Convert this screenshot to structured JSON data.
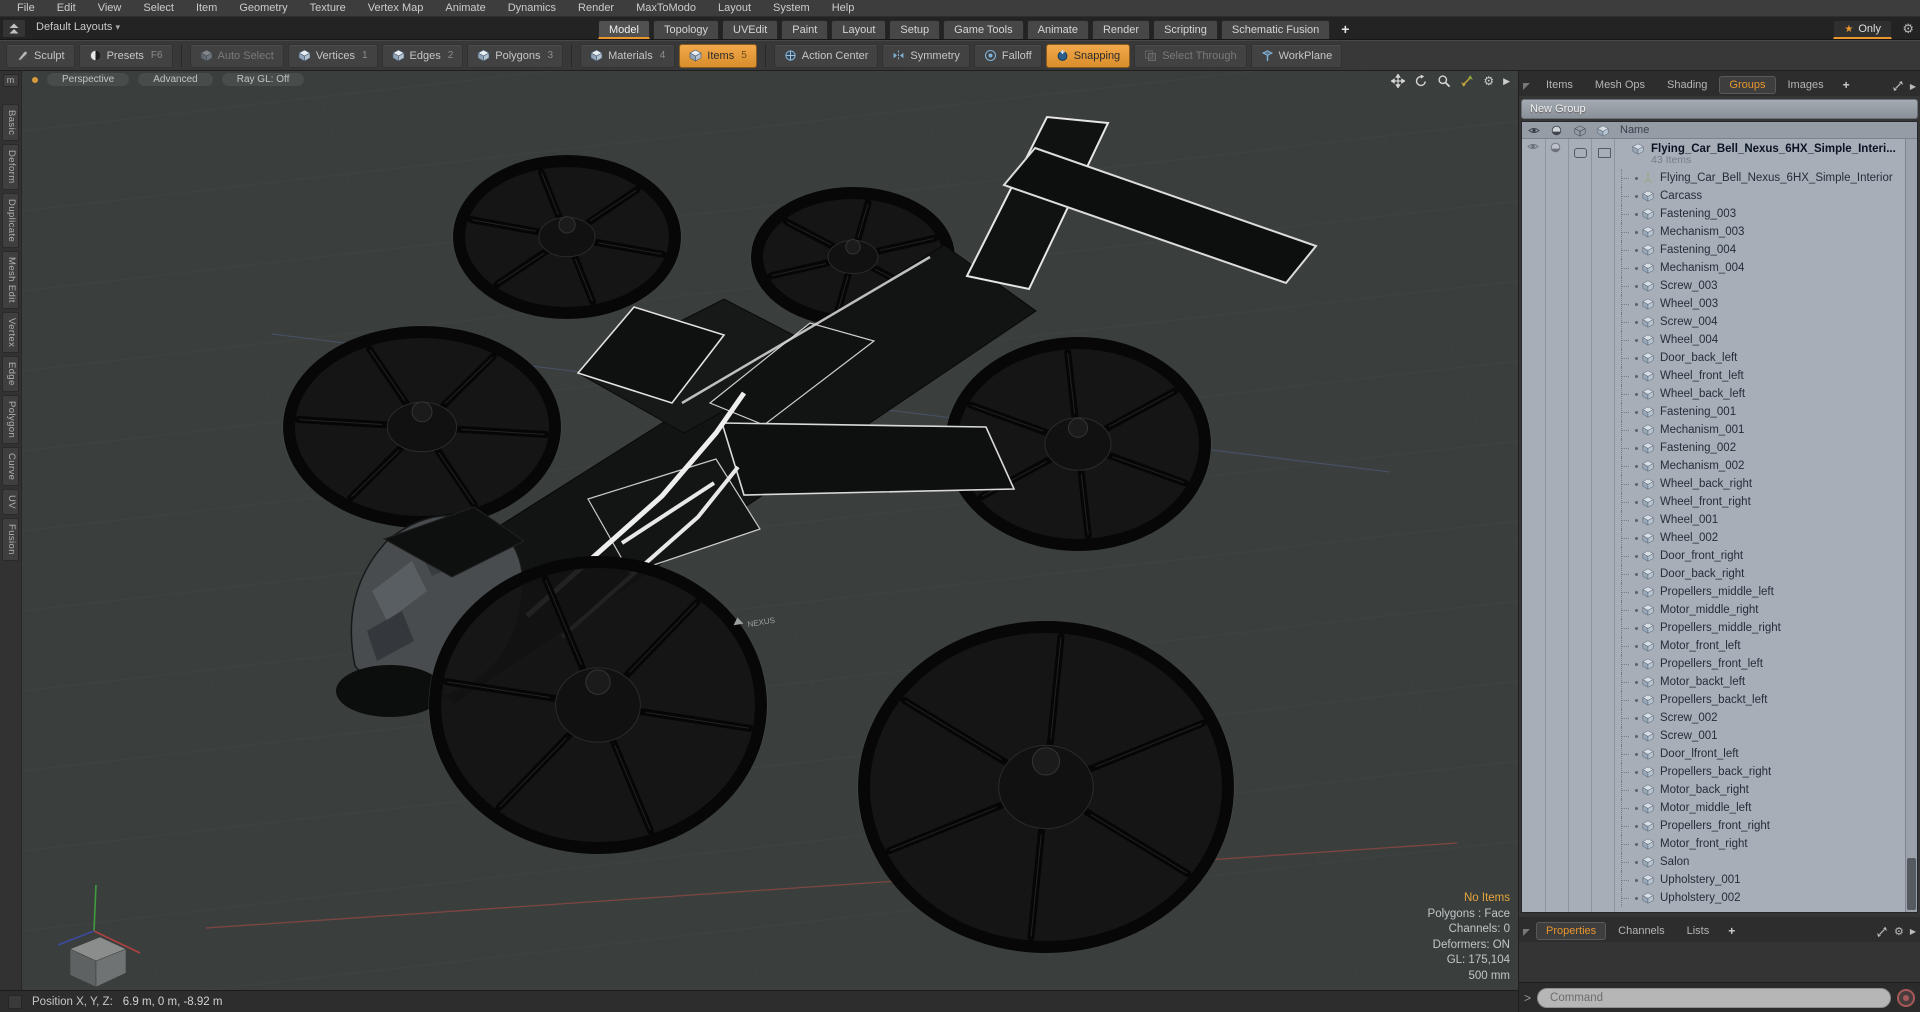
{
  "colors": {
    "accent": "#e8962e",
    "viewport_bg": "#3a3f3d",
    "list_bg": "#a7aeb8",
    "chrome_bg": "#3d3d3d"
  },
  "menu_bar": {
    "items": [
      "File",
      "Edit",
      "View",
      "Select",
      "Item",
      "Geometry",
      "Texture",
      "Vertex Map",
      "Animate",
      "Dynamics",
      "Render",
      "MaxToModo",
      "Layout",
      "System",
      "Help"
    ]
  },
  "layout_bar": {
    "default_layouts": "Default Layouts",
    "dropdown_arrow": "▾",
    "tabs": [
      "Model",
      "Topology",
      "UVEdit",
      "Paint",
      "Layout",
      "Setup",
      "Game Tools",
      "Animate",
      "Render",
      "Scripting",
      "Schematic Fusion"
    ],
    "active_tab": "Model",
    "add_tab": "+",
    "only_button": {
      "star": "★",
      "label": "Only"
    }
  },
  "toolbar": {
    "buttons": [
      {
        "label": "Sculpt",
        "shortcut": "",
        "icon": "brush",
        "state": "normal"
      },
      {
        "label": "Presets",
        "shortcut": "F6",
        "icon": "preset",
        "state": "normal"
      },
      {
        "label": "Auto Select",
        "shortcut": "",
        "icon": "cube",
        "state": "disabled"
      },
      {
        "label": "Vertices",
        "shortcut": "1",
        "icon": "cube",
        "state": "normal"
      },
      {
        "label": "Edges",
        "shortcut": "2",
        "icon": "cube",
        "state": "normal"
      },
      {
        "label": "Polygons",
        "shortcut": "3",
        "icon": "cube",
        "state": "normal"
      },
      {
        "label": "Materials",
        "shortcut": "4",
        "icon": "cube",
        "state": "normal"
      },
      {
        "label": "Items",
        "shortcut": "5",
        "icon": "cube",
        "state": "active"
      },
      {
        "label": "Action Center",
        "shortcut": "",
        "icon": "action",
        "state": "normal"
      },
      {
        "label": "Symmetry",
        "shortcut": "",
        "icon": "symmetry",
        "state": "normal"
      },
      {
        "label": "Falloff",
        "shortcut": "",
        "icon": "falloff",
        "state": "normal"
      },
      {
        "label": "Snapping",
        "shortcut": "",
        "icon": "snap",
        "state": "active"
      },
      {
        "label": "Select Through",
        "shortcut": "",
        "icon": "through",
        "state": "disabled"
      },
      {
        "label": "WorkPlane",
        "shortcut": "",
        "icon": "workplane",
        "state": "normal"
      }
    ],
    "separators_after": [
      "Presets",
      "Polygons",
      "Items"
    ]
  },
  "left_toolbox": {
    "badge": "m",
    "tabs": [
      "Basic",
      "Deform",
      "Duplicate",
      "Mesh Edit",
      "Vertex",
      "Edge",
      "Polygon",
      "Curve",
      "UV",
      "Fusion"
    ]
  },
  "viewport": {
    "header_buttons": [
      "Perspective",
      "Advanced",
      "Ray GL: Off"
    ],
    "controls": [
      "pan",
      "rotate",
      "zoom",
      "maximize",
      "settings",
      "more"
    ],
    "model_badge": "NEXUS",
    "status_info": {
      "highlight": "No Items",
      "lines": [
        "Polygons : Face",
        "Channels: 0",
        "Deformers: ON",
        "GL: 175,104",
        "500 mm"
      ]
    }
  },
  "right_panel": {
    "tabs": [
      "Items",
      "Mesh Ops",
      "Shading",
      "Groups",
      "Images"
    ],
    "active_tab": "Groups",
    "add_tab": "+",
    "corner_icons": [
      "expand",
      "more"
    ],
    "new_group_button": "New Group",
    "list": {
      "header_icons": [
        "eye",
        "render-ball",
        "wire-box",
        "solid-box"
      ],
      "name_header": "Name",
      "group": {
        "name": "Flying_Car_Bell_Nexus_6HX_Simple_Interi...",
        "items_count": "43 Items"
      },
      "items": [
        {
          "name": "Flying_Car_Bell_Nexus_6HX_Simple_Interior",
          "icon": "locator"
        },
        {
          "name": "Carcass",
          "icon": "mesh"
        },
        {
          "name": "Fastening_003",
          "icon": "mesh"
        },
        {
          "name": "Mechanism_003",
          "icon": "mesh"
        },
        {
          "name": "Fastening_004",
          "icon": "mesh"
        },
        {
          "name": "Mechanism_004",
          "icon": "mesh"
        },
        {
          "name": "Screw_003",
          "icon": "mesh"
        },
        {
          "name": "Wheel_003",
          "icon": "mesh"
        },
        {
          "name": "Screw_004",
          "icon": "mesh"
        },
        {
          "name": "Wheel_004",
          "icon": "mesh"
        },
        {
          "name": "Door_back_left",
          "icon": "mesh"
        },
        {
          "name": "Wheel_front_left",
          "icon": "mesh"
        },
        {
          "name": "Wheel_back_left",
          "icon": "mesh"
        },
        {
          "name": "Fastening_001",
          "icon": "mesh"
        },
        {
          "name": "Mechanism_001",
          "icon": "mesh"
        },
        {
          "name": "Fastening_002",
          "icon": "mesh"
        },
        {
          "name": "Mechanism_002",
          "icon": "mesh"
        },
        {
          "name": "Wheel_back_right",
          "icon": "mesh"
        },
        {
          "name": "Wheel_front_right",
          "icon": "mesh"
        },
        {
          "name": "Wheel_001",
          "icon": "mesh"
        },
        {
          "name": "Wheel_002",
          "icon": "mesh"
        },
        {
          "name": "Door_front_right",
          "icon": "mesh"
        },
        {
          "name": "Door_back_right",
          "icon": "mesh"
        },
        {
          "name": "Propellers_middle_left",
          "icon": "mesh"
        },
        {
          "name": "Motor_middle_right",
          "icon": "mesh"
        },
        {
          "name": "Propellers_middle_right",
          "icon": "mesh"
        },
        {
          "name": "Motor_front_left",
          "icon": "mesh"
        },
        {
          "name": "Propellers_front_left",
          "icon": "mesh"
        },
        {
          "name": "Motor_backt_left",
          "icon": "mesh"
        },
        {
          "name": "Propellers_backt_left",
          "icon": "mesh"
        },
        {
          "name": "Screw_002",
          "icon": "mesh"
        },
        {
          "name": "Screw_001",
          "icon": "mesh"
        },
        {
          "name": "Door_lfront_left",
          "icon": "mesh"
        },
        {
          "name": "Propellers_back_right",
          "icon": "mesh"
        },
        {
          "name": "Motor_back_right",
          "icon": "mesh"
        },
        {
          "name": "Motor_middle_left",
          "icon": "mesh"
        },
        {
          "name": "Propellers_front_right",
          "icon": "mesh"
        },
        {
          "name": "Motor_front_right",
          "icon": "mesh"
        },
        {
          "name": "Salon",
          "icon": "mesh"
        },
        {
          "name": "Upholstery_001",
          "icon": "mesh"
        },
        {
          "name": "Upholstery_002",
          "icon": "mesh"
        }
      ]
    }
  },
  "properties_panel": {
    "tabs": [
      "Properties",
      "Channels",
      "Lists"
    ],
    "active_tab": "Properties",
    "add_tab": "+",
    "corner_icons": [
      "expand",
      "settings",
      "more"
    ],
    "command": {
      "prompt": ">",
      "placeholder": "Command"
    }
  },
  "status_bar": {
    "label": "Position X, Y, Z:",
    "value": "6.9 m, 0 m, -8.92 m"
  }
}
